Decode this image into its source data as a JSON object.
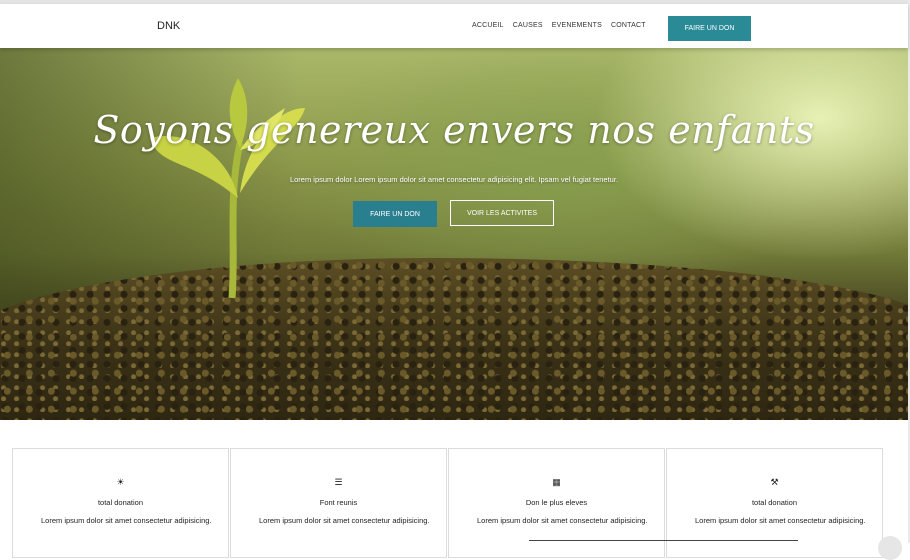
{
  "nav": {
    "brand": "DNK",
    "links": [
      "ACCUEIL",
      "CAUSES",
      "EVENEMENTS",
      "CONTACT"
    ],
    "cta": "FAIRE UN DON"
  },
  "hero": {
    "title": "Soyons genereux envers nos enfants",
    "subtitle": "Lorem ipsum dolor Lorem ipsum dolor sit amet consectetur adipisicing elit. Ipsam vel fugiat tenetur.",
    "primary_button": "FAIRE UN DON",
    "secondary_button": "VOIR LES ACTIVITES"
  },
  "cards": [
    {
      "icon": "sun-icon",
      "glyph": "☀",
      "title": "total donation",
      "text": "Lorem ipsum dolor sit amet consectetur adipisicing."
    },
    {
      "icon": "list-icon",
      "glyph": "☰",
      "title": "Font reunis",
      "text": "Lorem ipsum dolor sit amet consectetur adipisicing."
    },
    {
      "icon": "building-icon",
      "glyph": "▦",
      "title": "Don le plus eleves",
      "text": "Lorem ipsum dolor sit amet consectetur adipisicing."
    },
    {
      "icon": "tools-icon",
      "glyph": "⚒",
      "title": "total donation",
      "text": "Lorem ipsum dolor sit amet consectetur adipisicing."
    }
  ],
  "colors": {
    "accent": "#2a8a96",
    "button": "#2a7f8f"
  }
}
